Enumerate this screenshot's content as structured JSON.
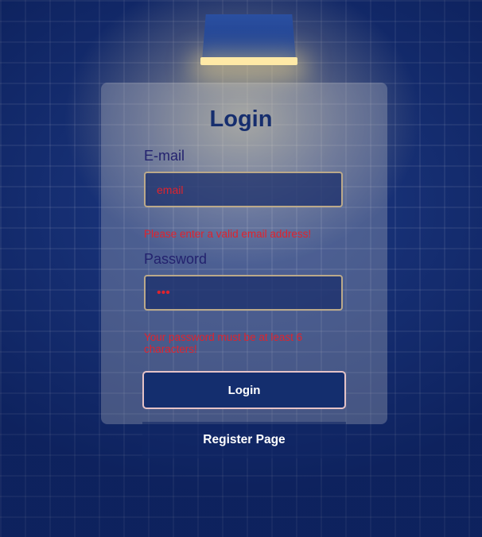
{
  "login_form": {
    "title": "Login",
    "email": {
      "label": "E-mail",
      "placeholder": "email",
      "value": "",
      "error": "Please enter a valid email address!"
    },
    "password": {
      "label": "Password",
      "value": "•••",
      "error": "Your password must be at least 6 characters!"
    },
    "submit_label": "Login",
    "register_label": "Register Page"
  },
  "colors": {
    "wall": "#14307a",
    "title": "#162e6e",
    "label": "#23226e",
    "error": "#e0232d",
    "button_bg": "#142e6e",
    "button_text": "#ffffff"
  },
  "icons": [
    "wall-lamp"
  ]
}
